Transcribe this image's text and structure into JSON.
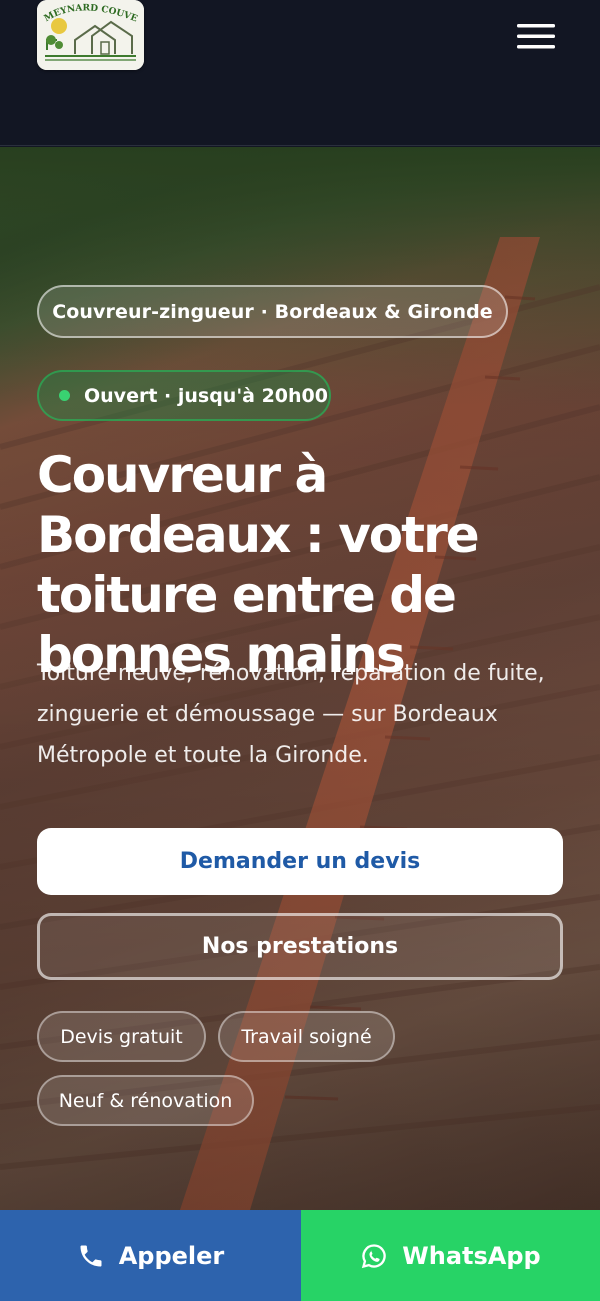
{
  "header": {
    "logo_text": "MEYNARD COUVERTURE",
    "menu_icon": "hamburger-menu-icon"
  },
  "hero": {
    "specialty": "Couvreur-zingueur · Bordeaux & Gironde",
    "status": "Ouvert · jusqu'à 20h00",
    "title": "Couvreur à Bordeaux : votre toiture entre de bonnes mains",
    "subtitle": "Toiture neuve, rénovation, réparation de fuite, zinguerie et démoussage — sur Bordeaux Métropole et toute la Gironde.",
    "cta_primary": "Demander un devis",
    "cta_secondary": "Nos prestations",
    "tags": [
      "Devis gratuit",
      "Travail soigné",
      "Neuf & rénovation"
    ]
  },
  "bottom_bar": {
    "call_label": "Appeler",
    "call_icon": "phone-icon",
    "whatsapp_label": "WhatsApp",
    "whatsapp_icon": "whatsapp-icon"
  },
  "colors": {
    "header_bg": "#121623",
    "brand_blue": "#2d63ad",
    "whatsapp_green": "#27d366",
    "status_green": "#39d271",
    "quote_text": "#1f5aa6"
  }
}
